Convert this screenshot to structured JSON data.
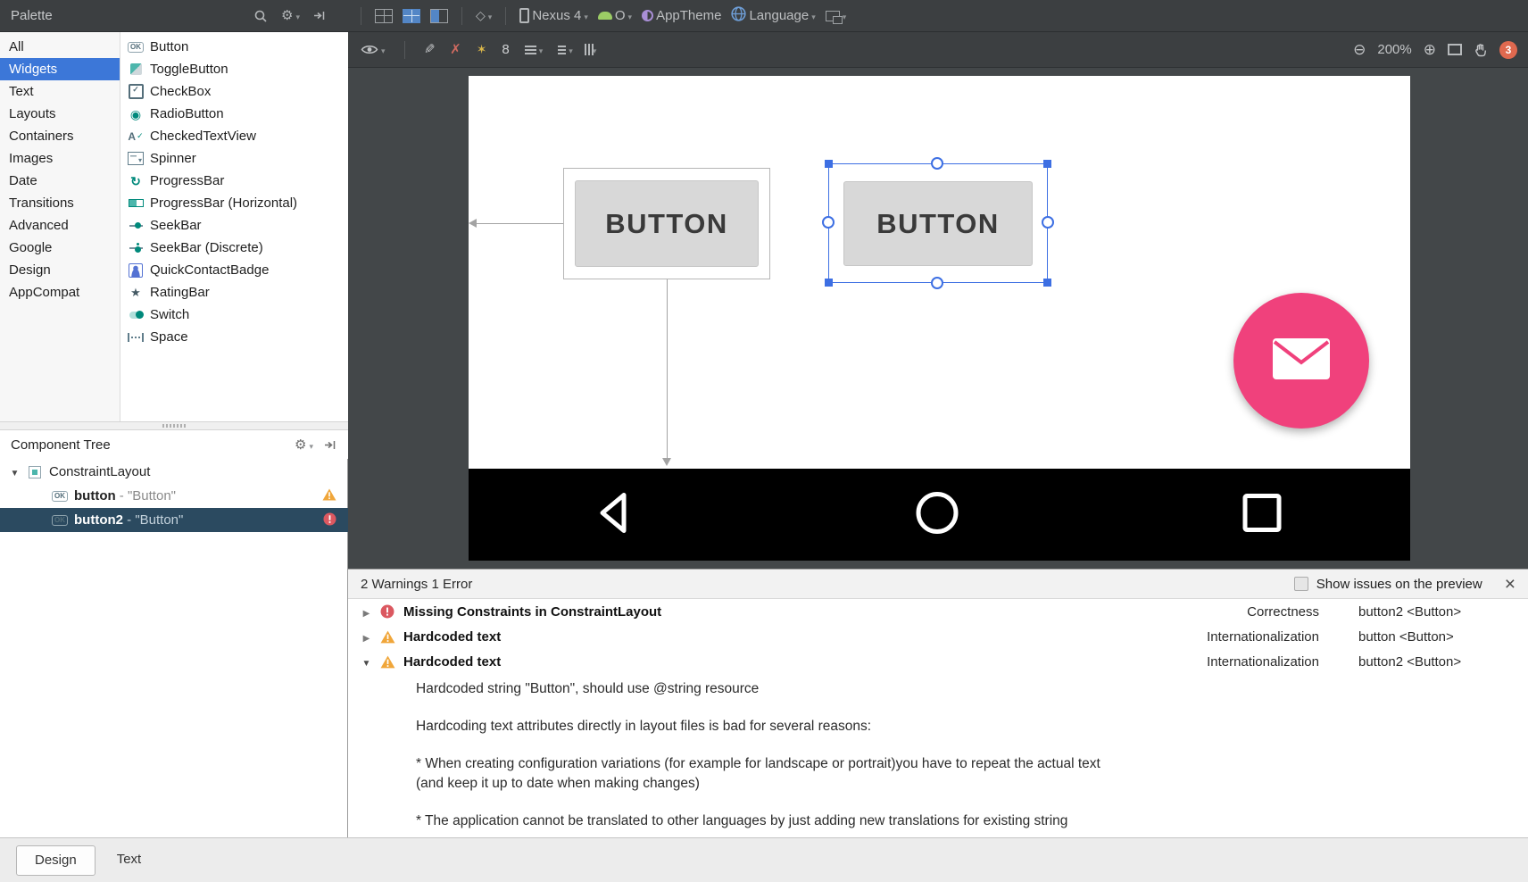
{
  "topbar": {
    "palette_label": "Palette",
    "device_label": "Nexus 4",
    "api_label": "O",
    "theme_label": "AppTheme",
    "language_label": "Language"
  },
  "palette": {
    "categories": [
      {
        "label": "All"
      },
      {
        "label": "Widgets",
        "selected": true
      },
      {
        "label": "Text"
      },
      {
        "label": "Layouts"
      },
      {
        "label": "Containers"
      },
      {
        "label": "Images"
      },
      {
        "label": "Date"
      },
      {
        "label": "Transitions"
      },
      {
        "label": "Advanced"
      },
      {
        "label": "Google"
      },
      {
        "label": "Design"
      },
      {
        "label": "AppCompat"
      }
    ],
    "components": [
      {
        "label": "Button",
        "icon": "button-widget-icon"
      },
      {
        "label": "ToggleButton",
        "icon": "togglebutton-widget-icon"
      },
      {
        "label": "CheckBox",
        "icon": "checkbox-widget-icon"
      },
      {
        "label": "RadioButton",
        "icon": "radiobutton-widget-icon"
      },
      {
        "label": "CheckedTextView",
        "icon": "checkedtextview-widget-icon"
      },
      {
        "label": "Spinner",
        "icon": "spinner-widget-icon"
      },
      {
        "label": "ProgressBar",
        "icon": "progressbar-widget-icon"
      },
      {
        "label": "ProgressBar (Horizontal)",
        "icon": "progressbar-horizontal-widget-icon"
      },
      {
        "label": "SeekBar",
        "icon": "seekbar-widget-icon"
      },
      {
        "label": "SeekBar (Discrete)",
        "icon": "seekbar-discrete-widget-icon"
      },
      {
        "label": "QuickContactBadge",
        "icon": "quickcontactbadge-widget-icon"
      },
      {
        "label": "RatingBar",
        "icon": "ratingbar-widget-icon"
      },
      {
        "label": "Switch",
        "icon": "switch-widget-icon"
      },
      {
        "label": "Space",
        "icon": "space-widget-icon"
      }
    ]
  },
  "component_tree": {
    "title": "Component Tree",
    "root_label": "ConstraintLayout",
    "node1_name": "button",
    "node1_suffix": " - \"Button\"",
    "node2_name": "button2",
    "node2_suffix": " - \"Button\""
  },
  "canvas_toolbar": {
    "margin_value": "8",
    "zoom_level": "200%",
    "issue_count": "3"
  },
  "design": {
    "button1_label": "BUTTON",
    "button2_label": "BUTTON"
  },
  "issues": {
    "header": "2 Warnings 1 Error",
    "show_on_preview_label": "Show issues on the preview",
    "rows": [
      {
        "severity": "error",
        "title": "Missing Constraints in ConstraintLayout",
        "category": "Correctness",
        "component": "button2 <Button>"
      },
      {
        "severity": "warning",
        "title": "Hardcoded text",
        "category": "Internationalization",
        "component": "button <Button>"
      },
      {
        "severity": "warning",
        "title": "Hardcoded text",
        "category": "Internationalization",
        "component": "button2 <Button>"
      }
    ],
    "detail_line1": "Hardcoded string \"Button\", should use @string resource",
    "detail_line2": "Hardcoding text attributes directly in layout files is bad for several reasons:",
    "detail_line3a": "* When creating configuration variations (for example for landscape or portrait)you have to repeat the actual text",
    "detail_line3b": "(and keep it up to date when making changes)",
    "detail_line4": "* The application cannot be translated to other languages by just adding new translations for existing string"
  },
  "bottom_tabs": {
    "design": "Design",
    "text": "Text"
  },
  "colors": {
    "selection_blue": "#3d6fe3",
    "palette_selected_blue": "#3c77d8",
    "fab_pink": "#f0417c",
    "warning_orange": "#f0a63a",
    "error_red": "#db5860",
    "toolbar_dark": "#3c3f41",
    "canvas_gray": "#434749"
  }
}
